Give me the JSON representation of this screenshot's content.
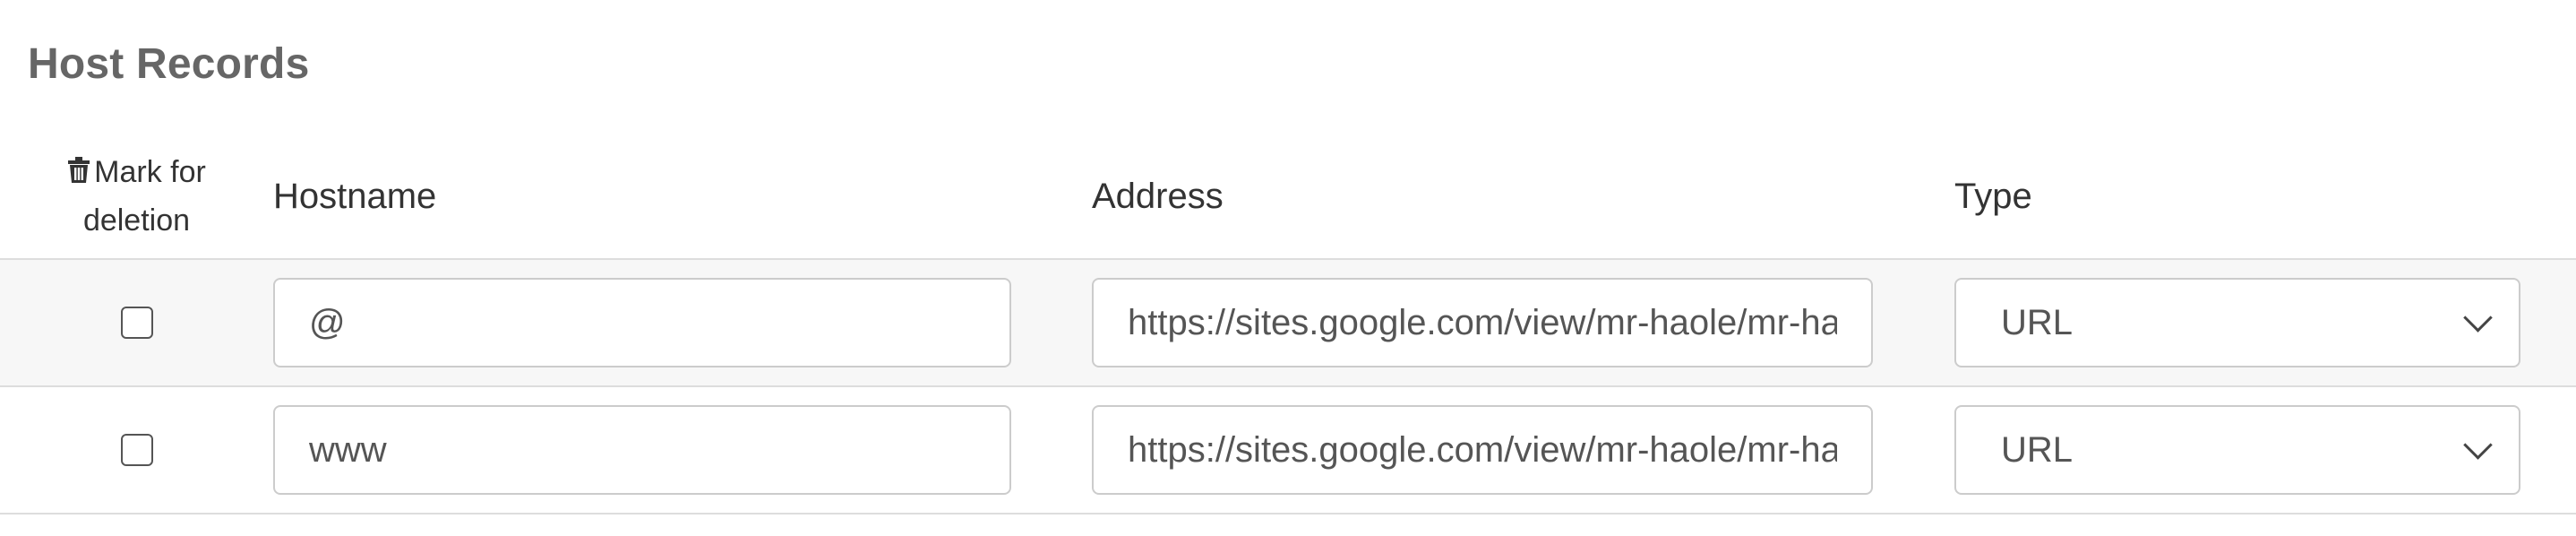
{
  "section": {
    "title": "Host Records"
  },
  "table": {
    "headers": {
      "delete_line1": "Mark for",
      "delete_line2": "deletion",
      "hostname": "Hostname",
      "address": "Address",
      "type": "Type"
    },
    "rows": [
      {
        "checked": false,
        "hostname": "@",
        "address": "https://sites.google.com/view/mr-haole/mr-haole",
        "type": "URL"
      },
      {
        "checked": false,
        "hostname": "www",
        "address": "https://sites.google.com/view/mr-haole/mr-haole",
        "type": "URL"
      }
    ]
  },
  "icons": {
    "delete": "trash-icon",
    "dropdown": "chevron-down-icon"
  },
  "colors": {
    "title": "#666666",
    "row_shade": "#f7f7f7",
    "border": "#cccccc"
  }
}
